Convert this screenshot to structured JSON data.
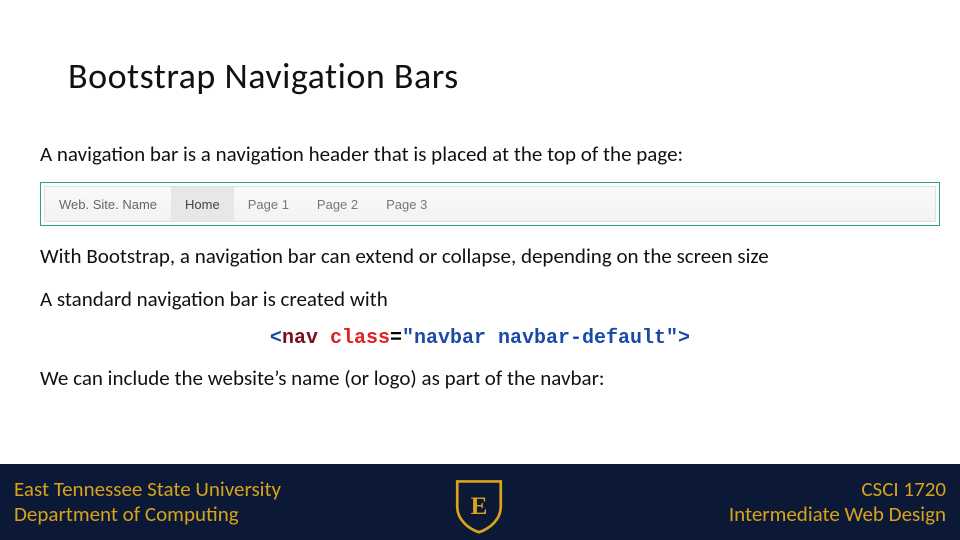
{
  "title": "Bootstrap Navigation Bars",
  "p1": "A navigation bar is a navigation header that is placed at the top of the page:",
  "navbar": {
    "brand": "Web. Site. Name",
    "items": [
      "Home",
      "Page 1",
      "Page 2",
      "Page 3"
    ]
  },
  "p2": "With Bootstrap, a navigation bar can extend or collapse, depending on the screen size",
  "p3": "A standard navigation bar is created with",
  "code": {
    "open": "<",
    "tag": "nav",
    "space": " ",
    "attr": "class",
    "eq": "=",
    "str": "\"navbar navbar-default\"",
    "close": ">"
  },
  "p4": "We can include the website’s name (or logo) as part of the navbar:",
  "footer": {
    "left1": "East Tennessee State University",
    "left2": "Department of Computing",
    "right1": "CSCI 1720",
    "right2": "Intermediate Web Design",
    "logo_letter": "E"
  }
}
